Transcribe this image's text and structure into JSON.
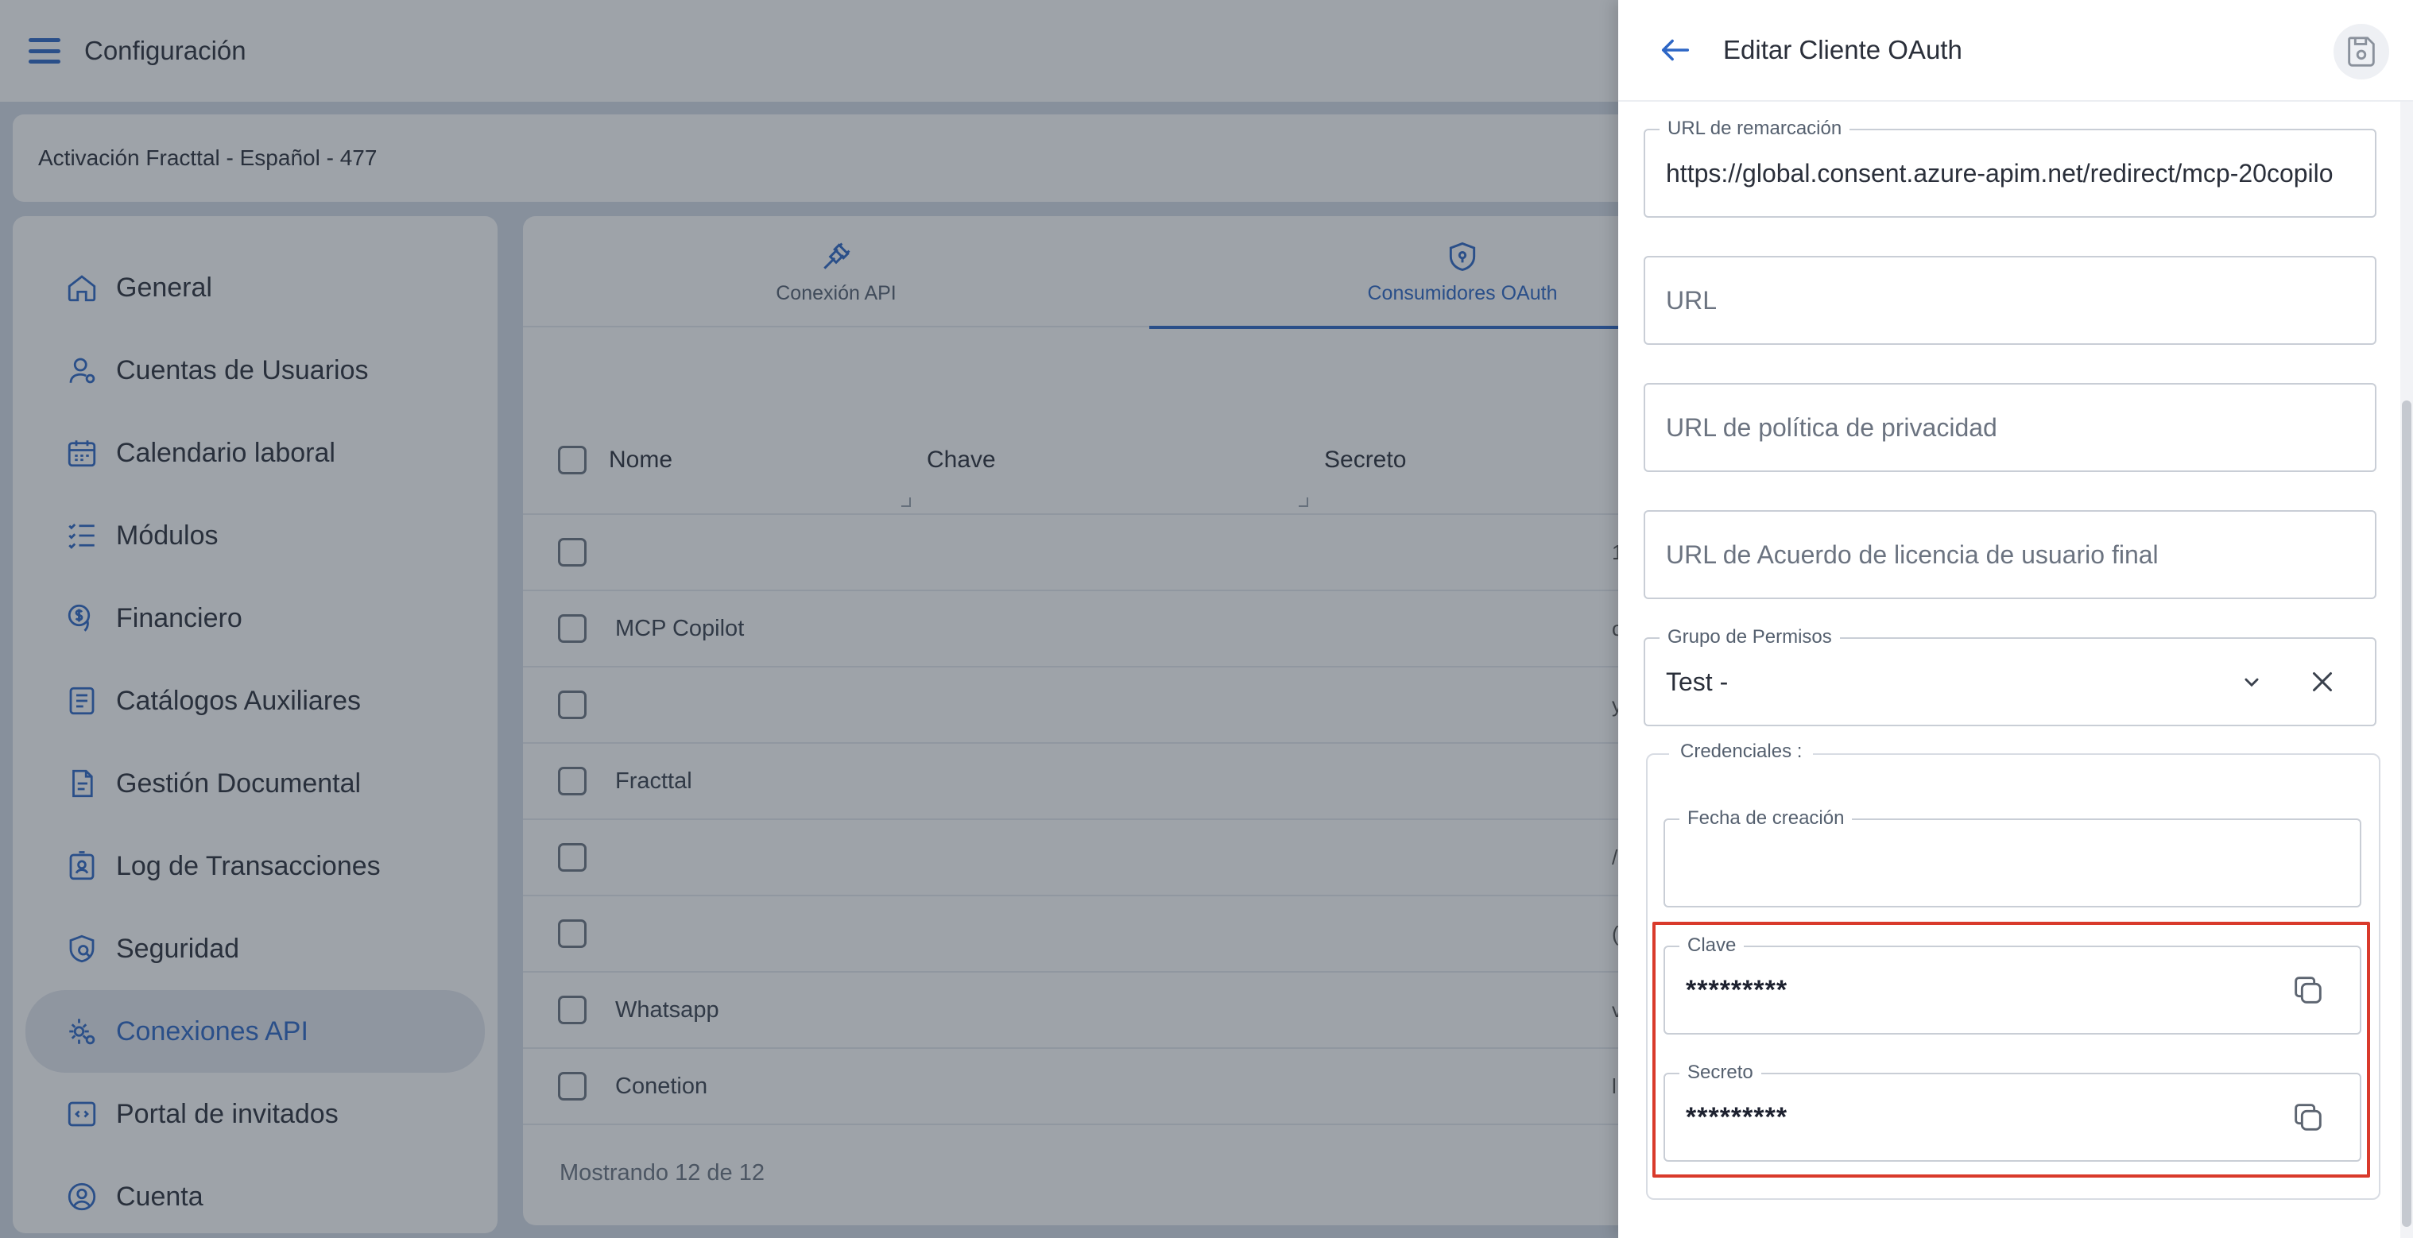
{
  "app": {
    "title": "Configuración",
    "org": "Activación Fracttal - Español - 477"
  },
  "sidebar": {
    "items": [
      {
        "label": "General",
        "icon": "home-icon",
        "active": false
      },
      {
        "label": "Cuentas de Usuarios",
        "icon": "user-icon",
        "active": false
      },
      {
        "label": "Calendario laboral",
        "icon": "calendar-icon",
        "active": false
      },
      {
        "label": "Módulos",
        "icon": "list-check-icon",
        "active": false
      },
      {
        "label": "Financiero",
        "icon": "money-icon",
        "active": false
      },
      {
        "label": "Catálogos Auxiliares",
        "icon": "catalog-icon",
        "active": false
      },
      {
        "label": "Gestión Documental",
        "icon": "document-icon",
        "active": false
      },
      {
        "label": "Log de Transacciones",
        "icon": "badge-icon",
        "active": false
      },
      {
        "label": "Seguridad",
        "icon": "security-icon",
        "active": false
      },
      {
        "label": "Conexiones API",
        "icon": "gear-icon",
        "active": true
      },
      {
        "label": "Portal de invitados",
        "icon": "code-icon",
        "active": false
      },
      {
        "label": "Cuenta",
        "icon": "account-icon",
        "active": false
      }
    ]
  },
  "tabs": [
    {
      "label": "Conexión API",
      "icon": "plug-icon",
      "active": false
    },
    {
      "label": "Consumidores OAuth",
      "icon": "shield-icon",
      "active": true
    }
  ],
  "table": {
    "headers": {
      "name": "Nome",
      "key": "Chave",
      "secret": "Secreto"
    },
    "rows": [
      {
        "name": "",
        "edge": "1"
      },
      {
        "name": "MCP Copilot",
        "edge": "c"
      },
      {
        "name": "",
        "edge": "y"
      },
      {
        "name": "Fracttal",
        "edge": ""
      },
      {
        "name": "",
        "edge": "/"
      },
      {
        "name": "",
        "edge": "("
      },
      {
        "name": "Whatsapp",
        "edge": "v"
      },
      {
        "name": "Conetion",
        "edge": "l"
      }
    ],
    "footer": "Mostrando 12 de 12"
  },
  "drawer": {
    "title": "Editar Cliente OAuth",
    "fields": {
      "redirect_label": "URL de remarcación",
      "redirect_value": "https://global.consent.azure-apim.net/redirect/mcp-20copilo",
      "url_placeholder": "URL",
      "privacy_placeholder": "URL de política de privacidad",
      "eula_placeholder": "URL de Acuerdo de licencia de usuario final",
      "group_label": "Grupo de Permisos",
      "group_value": "Test -"
    },
    "credentials": {
      "legend": "Credenciales :",
      "created_label": "Fecha de creación",
      "created_value": "",
      "key_label": "Clave",
      "key_value": "*********",
      "secret_label": "Secreto",
      "secret_value": "*********"
    }
  },
  "colors": {
    "accent": "#2d66c5",
    "highlight": "#d93a2b"
  }
}
